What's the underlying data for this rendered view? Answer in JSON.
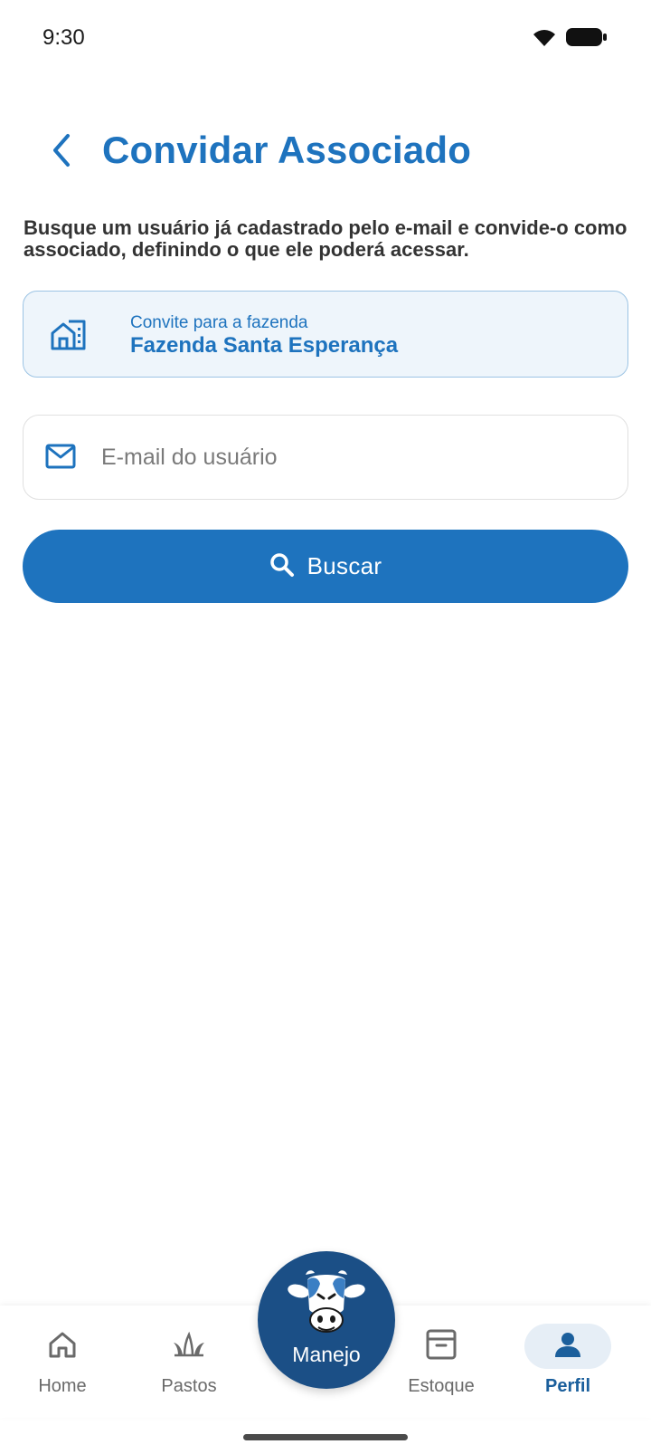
{
  "status_bar": {
    "time": "9:30"
  },
  "header": {
    "title": "Convidar Associado"
  },
  "description": "Busque um usuário já cadastrado pelo e-mail e convide-o como associado, definindo o que ele poderá acessar.",
  "farm_card": {
    "caption": "Convite para a fazenda",
    "name": "Fazenda Santa Esperança"
  },
  "email_field": {
    "value": "",
    "placeholder": "E-mail do usuário"
  },
  "search_button": {
    "label": "Buscar"
  },
  "bottom_nav": {
    "items": [
      {
        "label": "Home",
        "icon": "home-icon",
        "active": false
      },
      {
        "label": "Pastos",
        "icon": "grass-icon",
        "active": false
      },
      {
        "label": "Estoque",
        "icon": "archive-icon",
        "active": false
      },
      {
        "label": "Perfil",
        "icon": "person-icon",
        "active": true
      }
    ],
    "center": {
      "label": "Manejo",
      "icon": "cow-icon"
    }
  },
  "colors": {
    "primary": "#1e73be",
    "fab": "#1b4f86",
    "card_bg": "#eef5fb",
    "active_nav": "#1b5f9c"
  }
}
